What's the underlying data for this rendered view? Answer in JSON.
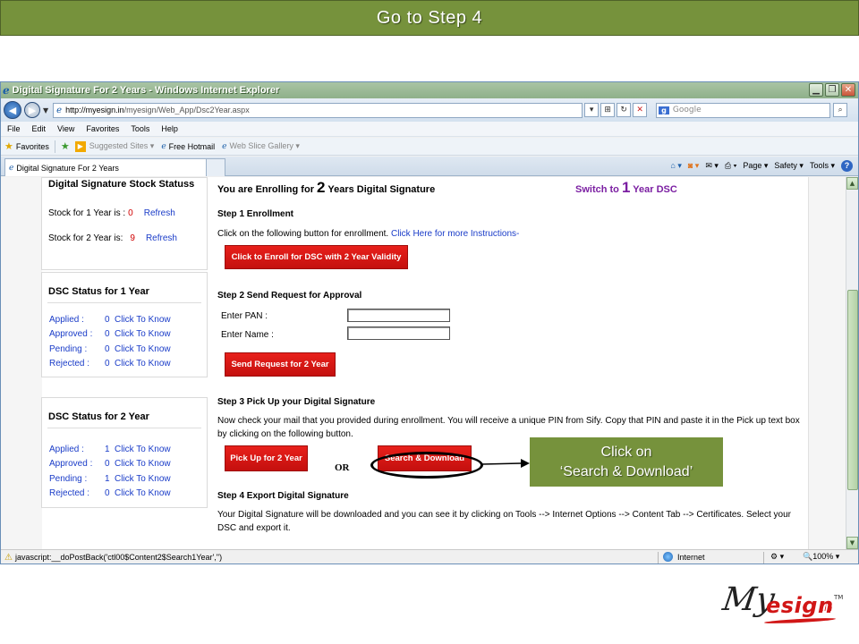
{
  "slide": {
    "banner": "Go to Step 4",
    "callout_line1": "Click on",
    "callout_line2": "‘Search & Download’"
  },
  "browser": {
    "title": "Digital Signature For 2 Years - Windows Internet Explorer",
    "url_host": "http://myesign.in",
    "url_path": "/myesign/Web_App/Dsc2Year.aspx",
    "search_placeholder": "Google",
    "menu": [
      "File",
      "Edit",
      "View",
      "Favorites",
      "Tools",
      "Help"
    ],
    "favorites_label": "Favorites",
    "fav_items": [
      "Suggested Sites ▾",
      "Free Hotmail",
      "Web Slice Gallery ▾"
    ],
    "tab_title": "Digital Signature For 2 Years",
    "cmd_items": [
      "Page ▾",
      "Safety ▾",
      "Tools ▾"
    ],
    "status_text": "javascript:__doPostBack('ctl00$Content2$Search1Year','')",
    "zone": "Internet",
    "zoom": "100%"
  },
  "sidebar": {
    "stock_title": "Digital Signature Stock Statuss",
    "stock_1yr_label": "Stock for 1 Year is :",
    "stock_1yr_value": "0",
    "stock_2yr_label": "Stock for 2 Year is:",
    "stock_2yr_value": "9",
    "refresh": "Refresh",
    "status1_title": "DSC Status for 1 Year",
    "status1_rows": [
      {
        "label": "Applied :",
        "count": "0",
        "link": "Click To Know"
      },
      {
        "label": "Approved :",
        "count": "0",
        "link": "Click To Know"
      },
      {
        "label": "Pending :",
        "count": "0",
        "link": "Click To Know"
      },
      {
        "label": "Rejected :",
        "count": "0",
        "link": "Click To Know"
      }
    ],
    "status2_title": "DSC Status for 2 Year",
    "status2_rows": [
      {
        "label": "Applied :",
        "count": "1",
        "link": "Click To Know"
      },
      {
        "label": "Approved :",
        "count": "0",
        "link": "Click To Know"
      },
      {
        "label": "Pending :",
        "count": "1",
        "link": "Click To Know"
      },
      {
        "label": "Rejected :",
        "count": "0",
        "link": "Click To Know"
      }
    ]
  },
  "main": {
    "header_pre": "You are Enrolling for",
    "header_num": "2",
    "header_post": "Years Digital Signature",
    "switch_pre": "Switch to",
    "switch_num": "1",
    "switch_post": "Year DSC",
    "step1_title": "Step 1 Enrollment",
    "step1_text": "Click on the following button for enrollment.",
    "step1_link": "Click Here for more Instructions-",
    "step1_button": "Click to Enroll for DSC with 2 Year Validity",
    "step2_title": "Step 2  Send Request for Approval",
    "pan_label": "Enter PAN :",
    "name_label": "Enter Name :",
    "step2_button": "Send Request for 2 Year",
    "step3_title": "Step 3 Pick Up your Digital Signature",
    "step3_text": "Now check your mail that you provided during enrollment. You will receive a unique PIN from Sify. Copy that PIN and paste it in the Pick up text box by clicking on the following button.",
    "pickup_button": "Pick Up for 2 Year",
    "or": "OR",
    "search_button": "Search & Download",
    "step4_title": "Step 4 Export Digital Signature",
    "step4_text": "Your Digital Signature will be downloaded and you can see it by clicking on Tools --> Internet Options --> Content Tab --> Certificates. Select your DSC and export it."
  },
  "logo": {
    "my": "My",
    "esign": "esign",
    "tld": ".in",
    "tm": "TM"
  }
}
